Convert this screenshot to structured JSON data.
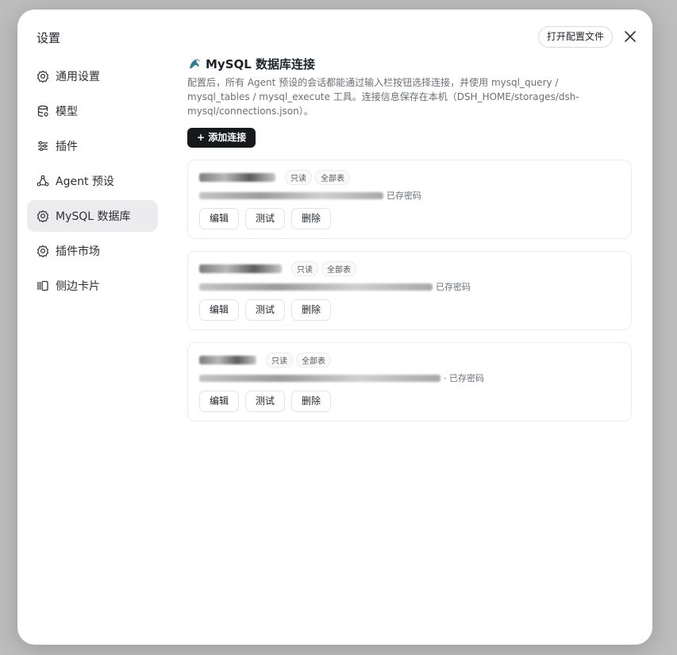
{
  "modal": {
    "title": "设置",
    "open_config_label": "打开配置文件"
  },
  "sidebar": {
    "items": [
      {
        "label": "通用设置",
        "icon": "gear-icon"
      },
      {
        "label": "模型",
        "icon": "database-icon"
      },
      {
        "label": "插件",
        "icon": "sliders-icon"
      },
      {
        "label": "Agent 预设",
        "icon": "agent-icon"
      },
      {
        "label": "MySQL 数据库",
        "icon": "gear-icon",
        "active": true
      },
      {
        "label": "插件市场",
        "icon": "gear-icon"
      },
      {
        "label": "侧边卡片",
        "icon": "cards-icon"
      }
    ]
  },
  "main": {
    "heading": "MySQL 数据库连接",
    "description": "配置后，所有 Agent 预设的会话都能通过输入栏按钮选择连接，并使用 mysql_query / mysql_tables / mysql_execute 工具。连接信息保存在本机（DSH_HOME/storages/dsh-mysql/connections.json）。",
    "add_label": "+ 添加连接",
    "connections": [
      {
        "tag_readonly": "只读",
        "tag_tables": "全部表",
        "password_status": "已存密码",
        "edit": "编辑",
        "test": "测试",
        "delete": "删除"
      },
      {
        "tag_readonly": "只读",
        "tag_tables": "全部表",
        "password_status": "已存密码",
        "edit": "编辑",
        "test": "测试",
        "delete": "删除"
      },
      {
        "tag_readonly": "只读",
        "tag_tables": "全部表",
        "password_status": "· 已存密码",
        "edit": "编辑",
        "test": "测试",
        "delete": "删除"
      }
    ]
  },
  "colors": {
    "accent": "#16181b",
    "active_nav": "#ececef",
    "backdrop": "#bdbdbd"
  }
}
